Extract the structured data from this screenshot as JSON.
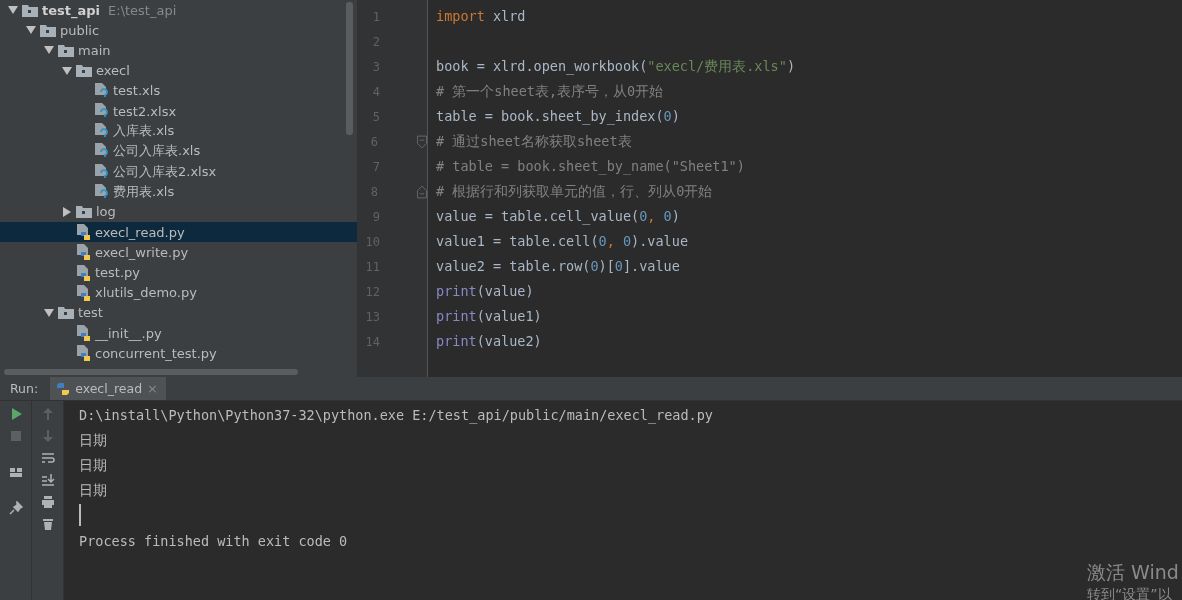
{
  "project_tree": {
    "items": [
      {
        "name": "test_api",
        "path": "E:\\test_api",
        "kind": "folder",
        "expanded": true,
        "selected": false,
        "children": [
          {
            "name": "public",
            "kind": "folder",
            "expanded": true,
            "selected": false,
            "children": [
              {
                "name": "main",
                "kind": "folder",
                "expanded": true,
                "selected": false,
                "children": [
                  {
                    "name": "execl",
                    "kind": "folder",
                    "expanded": true,
                    "selected": false,
                    "children": [
                      {
                        "name": "test.xls",
                        "kind": "unknown_file",
                        "selected": false
                      },
                      {
                        "name": "test2.xlsx",
                        "kind": "unknown_file",
                        "selected": false
                      },
                      {
                        "name": "入库表.xls",
                        "kind": "unknown_file",
                        "selected": false
                      },
                      {
                        "name": "公司入库表.xls",
                        "kind": "unknown_file",
                        "selected": false
                      },
                      {
                        "name": "公司入库表2.xlsx",
                        "kind": "unknown_file",
                        "selected": false
                      },
                      {
                        "name": "费用表.xls",
                        "kind": "unknown_file",
                        "selected": false
                      }
                    ]
                  },
                  {
                    "name": "log",
                    "kind": "folder",
                    "expanded": false,
                    "selected": false
                  },
                  {
                    "name": "execl_read.py",
                    "kind": "python_file",
                    "selected": true
                  },
                  {
                    "name": "execl_write.py",
                    "kind": "python_file",
                    "selected": false
                  },
                  {
                    "name": "test.py",
                    "kind": "python_file",
                    "selected": false
                  },
                  {
                    "name": "xlutils_demo.py",
                    "kind": "python_file",
                    "selected": false
                  }
                ]
              },
              {
                "name": "test",
                "kind": "folder",
                "expanded": true,
                "selected": false,
                "children": [
                  {
                    "name": "__init__.py",
                    "kind": "python_file",
                    "selected": false
                  },
                  {
                    "name": "concurrent_test.py",
                    "kind": "python_file",
                    "selected": false
                  }
                ]
              }
            ]
          }
        ]
      }
    ]
  },
  "editor": {
    "lines": [
      {
        "number": "1",
        "kind": "plain",
        "tokens": [
          {
            "kind": "keyword",
            "text": "import"
          },
          {
            "kind": "plain",
            "text": " xlrd"
          }
        ]
      },
      {
        "number": "2",
        "kind": "plain"
      },
      {
        "number": "3",
        "kind": "plain",
        "tokens": [
          {
            "kind": "plain",
            "text": "book = xlrd.open_workbook("
          },
          {
            "kind": "string",
            "text": "\"execl/费用表.xls\""
          },
          {
            "kind": "plain",
            "text": ")"
          }
        ]
      },
      {
        "number": "4",
        "kind": "plain",
        "tokens": [
          {
            "kind": "comment",
            "text": "# 第一个sheet表,表序号，从0开始"
          }
        ]
      },
      {
        "number": "5",
        "kind": "plain",
        "tokens": [
          {
            "kind": "plain",
            "text": "table = book.sheet_by_index("
          },
          {
            "kind": "number",
            "text": "0"
          },
          {
            "kind": "plain",
            "text": ")"
          }
        ]
      },
      {
        "number": "6",
        "kind": "fold_start",
        "tokens": [
          {
            "kind": "comment",
            "text": "# 通过sheet名称获取sheet表"
          }
        ]
      },
      {
        "number": "7",
        "kind": "plain",
        "tokens": [
          {
            "kind": "comment",
            "text": "# table = book.sheet_by_name(\"Sheet1\")"
          }
        ]
      },
      {
        "number": "8",
        "kind": "fold_end",
        "tokens": [
          {
            "kind": "comment",
            "text": "# 根据行和列获取单元的值，行、列从0开始"
          }
        ]
      },
      {
        "number": "9",
        "kind": "plain",
        "tokens": [
          {
            "kind": "plain",
            "text": "value = table.cell_value("
          },
          {
            "kind": "number",
            "text": "0"
          },
          {
            "kind": "keyword",
            "text": ", "
          },
          {
            "kind": "number",
            "text": "0"
          },
          {
            "kind": "plain",
            "text": ")"
          }
        ]
      },
      {
        "number": "10",
        "kind": "plain",
        "tokens": [
          {
            "kind": "plain",
            "text": "value1 = table.cell("
          },
          {
            "kind": "number",
            "text": "0"
          },
          {
            "kind": "keyword",
            "text": ", "
          },
          {
            "kind": "number",
            "text": "0"
          },
          {
            "kind": "plain",
            "text": ").value"
          }
        ]
      },
      {
        "number": "11",
        "kind": "plain",
        "tokens": [
          {
            "kind": "plain",
            "text": "value2 = table.row("
          },
          {
            "kind": "number",
            "text": "0"
          },
          {
            "kind": "plain",
            "text": ")["
          },
          {
            "kind": "number",
            "text": "0"
          },
          {
            "kind": "plain",
            "text": "].value"
          }
        ]
      },
      {
        "number": "12",
        "kind": "plain",
        "tokens": [
          {
            "kind": "builtin",
            "text": "print"
          },
          {
            "kind": "plain",
            "text": "(value)"
          }
        ]
      },
      {
        "number": "13",
        "kind": "plain",
        "tokens": [
          {
            "kind": "builtin",
            "text": "print"
          },
          {
            "kind": "plain",
            "text": "(value1)"
          }
        ]
      },
      {
        "number": "14",
        "kind": "plain",
        "tokens": [
          {
            "kind": "builtin",
            "text": "print"
          },
          {
            "kind": "plain",
            "text": "(value2)"
          }
        ]
      }
    ]
  },
  "run_panel": {
    "label": "Run:",
    "tab": {
      "title": "execl_read",
      "close": "×",
      "selected": true
    },
    "console": [
      {
        "kind": "text",
        "text": "D:\\install\\Python\\Python37-32\\python.exe E:/test_api/public/main/execl_read.py"
      },
      {
        "kind": "text",
        "text": "日期"
      },
      {
        "kind": "text",
        "text": "日期"
      },
      {
        "kind": "text",
        "text": "日期"
      },
      {
        "kind": "cursor"
      },
      {
        "kind": "text",
        "text": "Process finished with exit code 0"
      }
    ]
  },
  "os_overlay": {
    "lines": [
      "激活 Wind",
      "转到“设置”以"
    ]
  }
}
